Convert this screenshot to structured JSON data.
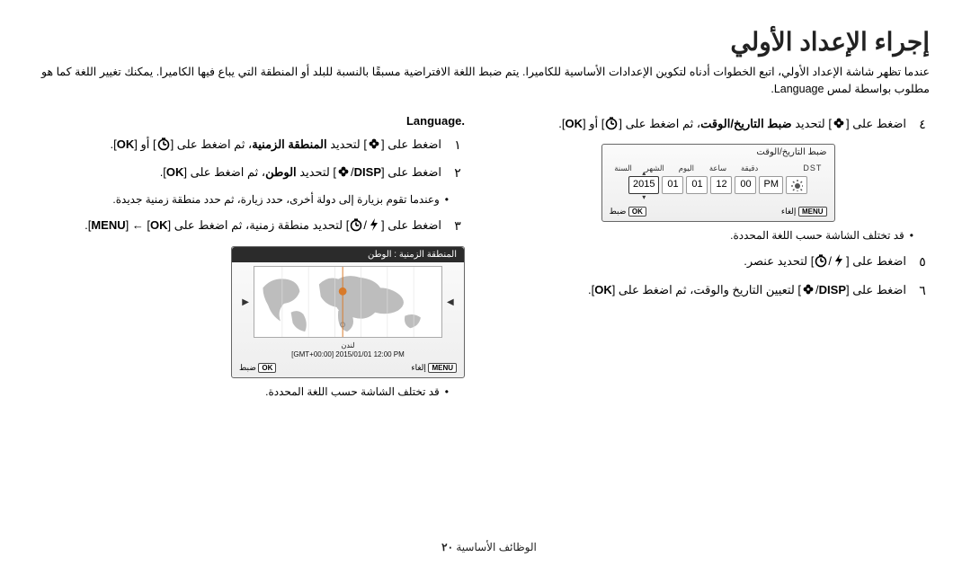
{
  "title": "إجراء الإعداد الأولي",
  "intro": "عندما تظهر شاشة الإعداد الأولي، اتبع الخطوات أدناه لتكوين الإعدادات الأساسية للكاميرا. يتم ضبط اللغة الافتراضية مسبقًا بالنسبة للبلد أو المنطقة التي يباع فيها الكاميرا. يمكنك تغيير اللغة كما هو مطلوب بواسطة لمس Language.",
  "right": {
    "section": "Language.",
    "step1": {
      "num": "١",
      "pre": "اضغط على [",
      "mid": "] لتحديد ",
      "bold": "المنطقة الزمنية",
      "post": "، ثم اضغط على [",
      "tail": "] أو [",
      "ok": "OK",
      "end": "]."
    },
    "step2": {
      "num": "٢",
      "pre": "اضغط على [",
      "disp": "DISP",
      "mid2": "] لتحديد ",
      "bold": "الوطن",
      "post": "، ثم اضغط على [",
      "ok": "OK",
      "end": "]."
    },
    "bullet2": "وعندما تقوم بزيارة إلى دولة أخرى، حدد زيارة، ثم حدد منطقة زمنية جديدة.",
    "step3": {
      "num": "٣",
      "txt1": "اضغط على [",
      "txt2": "] لتحديد منطقة زمنية، ثم اضغط على [",
      "ok": "OK",
      "arrow": "] ← [",
      "menu": "MENU",
      "end": "]."
    },
    "map": {
      "header": "المنطقة الزمنية : الوطن",
      "city": "لندن",
      "gmt": "[GMT+00:00] 2015/01/01  12:00 PM",
      "back_key": "MENU",
      "back_lbl": "إلغاء",
      "set_key": "OK",
      "set_lbl": "ضبط"
    },
    "note": "قد تختلف الشاشة حسب اللغة المحددة."
  },
  "left": {
    "step4": {
      "num": "٤",
      "pre": "اضغط على [",
      "mid": "] لتحديد ",
      "bold": "ضبط التاريخ/الوقت",
      "post": "، ثم اضغط على [",
      "tail": "] أو [",
      "ok": "OK",
      "end": "]."
    },
    "dt": {
      "header": "ضبط التاريخ/الوقت",
      "labels": [
        "السنة",
        "الشهر",
        "اليوم",
        "ساعة",
        "دقيقة"
      ],
      "dst_label": "DST",
      "year": "2015",
      "month": "01",
      "day": "01",
      "hour": "12",
      "min": "00",
      "ampm": "PM",
      "back_key": "MENU",
      "back_lbl": "إلغاء",
      "set_key": "OK",
      "set_lbl": "ضبط"
    },
    "bullet4": "قد تختلف الشاشة حسب اللغة المحددة.",
    "step5": {
      "num": "٥",
      "pre": "اضغط على [",
      "post": "] لتحديد عنصر."
    },
    "step6": {
      "num": "٦",
      "pre": "اضغط على [",
      "disp": "DISP",
      "mid": "] لتعيين التاريخ والوقت، ثم اضغط على [",
      "ok": "OK",
      "end": "]."
    }
  },
  "footer": {
    "section": "الوظائف الأساسية",
    "page": "٢٠"
  }
}
